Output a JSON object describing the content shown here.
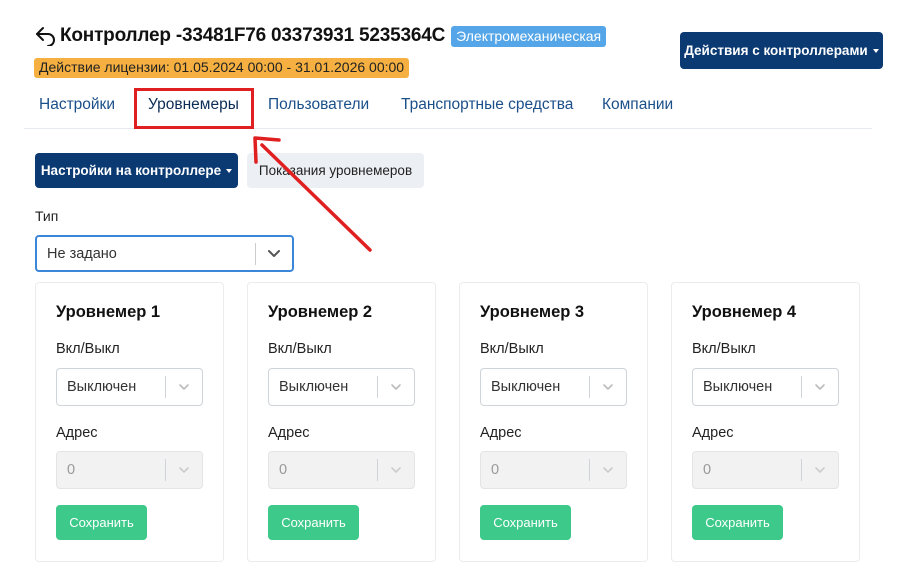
{
  "header": {
    "title": "Контроллер -33481F76 03373931 5235364C",
    "type_badge": "Электромеханическая",
    "license": "Действие лицензии: 01.05.2024 00:00 - 31.01.2026 00:00",
    "actions_label": "Действия с контроллерами"
  },
  "tabs": [
    {
      "label": "Настройки"
    },
    {
      "label": "Уровнемеры"
    },
    {
      "label": "Пользователи"
    },
    {
      "label": "Транспортные средства"
    },
    {
      "label": "Компании"
    }
  ],
  "active_tab": "Уровнемеры",
  "subtabs": {
    "settings_label": "Настройки на контроллере",
    "readings_label": "Показания уровнемеров"
  },
  "type_field": {
    "label": "Тип",
    "value": "Не задано"
  },
  "gauges": [
    {
      "title": "Уровнемер 1",
      "onoff_label": "Вкл/Выкл",
      "onoff_value": "Выключен",
      "address_label": "Адрес",
      "address_value": "0",
      "save_label": "Сохранить"
    },
    {
      "title": "Уровнемер 2",
      "onoff_label": "Вкл/Выкл",
      "onoff_value": "Выключен",
      "address_label": "Адрес",
      "address_value": "0",
      "save_label": "Сохранить"
    },
    {
      "title": "Уровнемер 3",
      "onoff_label": "Вкл/Выкл",
      "onoff_value": "Выключен",
      "address_label": "Адрес",
      "address_value": "0",
      "save_label": "Сохранить"
    },
    {
      "title": "Уровнемер 4",
      "onoff_label": "Вкл/Выкл",
      "onoff_value": "Выключен",
      "address_label": "Адрес",
      "address_value": "0",
      "save_label": "Сохранить"
    }
  ],
  "colors": {
    "primary": "#0b3a73",
    "accent_badge": "#55a6e8",
    "license_badge": "#f5b041",
    "save": "#3cc98a",
    "annotation": "#e02020"
  },
  "icons": {
    "back": "back-arrow-icon",
    "dropdown": "chevron-down-icon",
    "caret": "caret-down-icon"
  }
}
